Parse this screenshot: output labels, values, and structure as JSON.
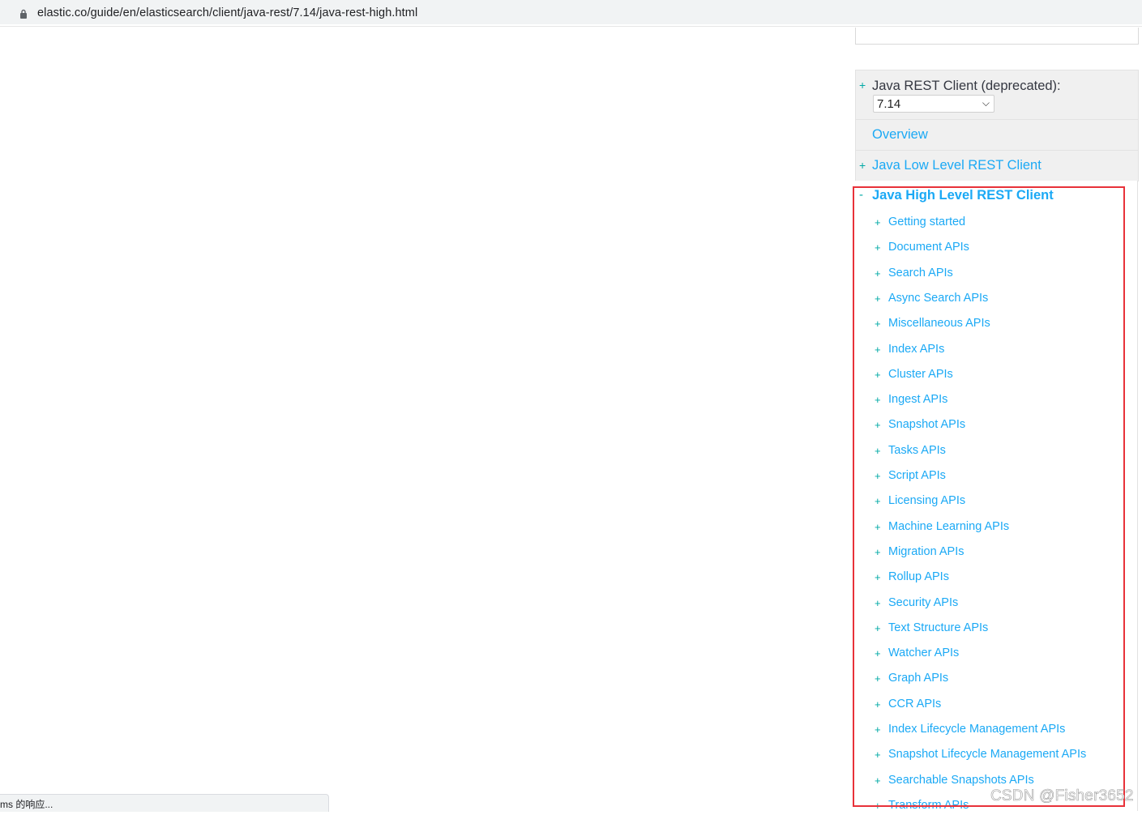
{
  "browser": {
    "url": "elastic.co/guide/en/elasticsearch/client/java-rest/7.14/java-rest-high.html"
  },
  "sidebar": {
    "version_section": {
      "title": "Java REST Client (deprecated):",
      "selected_version": "7.14"
    },
    "overview_label": "Overview",
    "low_level_label": "Java Low Level REST Client",
    "high_level": {
      "title": "Java High Level REST Client",
      "items": [
        {
          "label": "Getting started"
        },
        {
          "label": "Document APIs"
        },
        {
          "label": "Search APIs"
        },
        {
          "label": "Async Search APIs"
        },
        {
          "label": "Miscellaneous APIs"
        },
        {
          "label": "Index APIs"
        },
        {
          "label": "Cluster APIs"
        },
        {
          "label": "Ingest APIs"
        },
        {
          "label": "Snapshot APIs"
        },
        {
          "label": "Tasks APIs"
        },
        {
          "label": "Script APIs"
        },
        {
          "label": "Licensing APIs"
        },
        {
          "label": "Machine Learning APIs"
        },
        {
          "label": "Migration APIs"
        },
        {
          "label": "Rollup APIs"
        },
        {
          "label": "Security APIs"
        },
        {
          "label": "Text Structure APIs"
        },
        {
          "label": "Watcher APIs"
        },
        {
          "label": "Graph APIs"
        },
        {
          "label": "CCR APIs"
        },
        {
          "label": "Index Lifecycle Management APIs"
        },
        {
          "label": "Snapshot Lifecycle Management APIs"
        },
        {
          "label": "Searchable Snapshots APIs"
        },
        {
          "label": "Transform APIs"
        }
      ]
    }
  },
  "status_bar": {
    "text": "ms 的响应..."
  },
  "watermark": "CSDN @Fisher3652",
  "colors": {
    "link": "#1ba9f5",
    "teal": "#00a9a5",
    "highlight": "#e8323a"
  }
}
